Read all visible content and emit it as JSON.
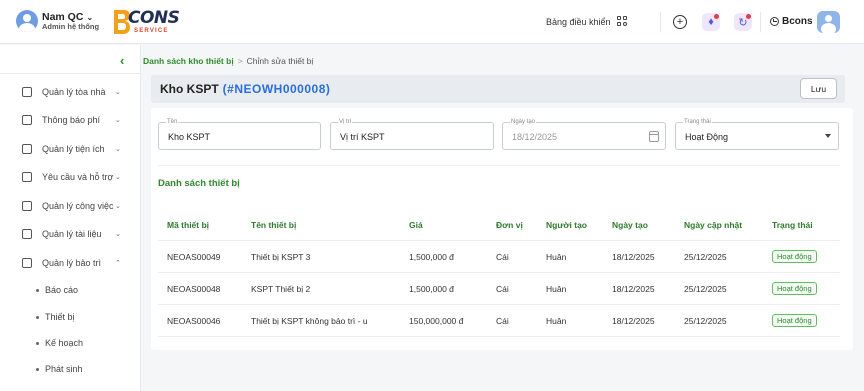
{
  "user": {
    "name": "Nam QC",
    "role": "Admin hệ thống"
  },
  "logo": {
    "word": "CONS",
    "sub": "SERVICE"
  },
  "topbar": {
    "dashboard_label": "Bảng điều khiển",
    "org_name": "Bcons"
  },
  "sidebar": {
    "items": [
      {
        "label": "Quản lý tòa nhà",
        "icon": "building-icon"
      },
      {
        "label": "Thông báo phí",
        "icon": "receipt-icon"
      },
      {
        "label": "Quản lý tiện ích",
        "icon": "grid-icon"
      },
      {
        "label": "Yêu cầu và hỗ trợ",
        "icon": "ticket-icon"
      },
      {
        "label": "Quản lý công việc",
        "icon": "task-icon"
      },
      {
        "label": "Quản lý tài liệu",
        "icon": "document-icon"
      },
      {
        "label": "Quản lý bảo trì",
        "icon": "archive-icon"
      }
    ],
    "subitems": [
      {
        "label": "Báo cáo"
      },
      {
        "label": "Thiết bị"
      },
      {
        "label": "Kế hoạch"
      },
      {
        "label": "Phát sinh"
      }
    ]
  },
  "breadcrumb": {
    "parent": "Danh sách kho thiết bị",
    "current": "Chỉnh sửa thiết bị"
  },
  "header": {
    "title": "Kho KSPT",
    "code": "(#NEOWH000008)",
    "save_label": "Lưu"
  },
  "form": {
    "name": {
      "label": "Tên",
      "value": "Kho KSPT"
    },
    "location": {
      "label": "Vị trí",
      "value": "Vị trí KSPT"
    },
    "created_date": {
      "label": "Ngày tạo",
      "value": "18/12/2025"
    },
    "status": {
      "label": "Trạng thái",
      "value": "Hoạt Động"
    }
  },
  "devices": {
    "title": "Danh sách thiết bị",
    "columns": [
      "Mã thiết bị",
      "Tên thiết bị",
      "Giá",
      "Đơn vị",
      "Người tạo",
      "Ngày tạo",
      "Ngày cập nhật",
      "Trạng thái"
    ],
    "rows": [
      {
        "code": "NEOAS00049",
        "name": "Thiết bị KSPT 3",
        "price": "1,500,000 đ",
        "unit": "Cái",
        "creator": "Huân",
        "created": "18/12/2025",
        "updated": "25/12/2025",
        "status": "Hoạt động"
      },
      {
        "code": "NEOAS00048",
        "name": "KSPT Thiết bị 2",
        "price": "1,500,000 đ",
        "unit": "Cái",
        "creator": "Huân",
        "created": "18/12/2025",
        "updated": "25/12/2025",
        "status": "Hoạt động"
      },
      {
        "code": "NEOAS00046",
        "name": "Thiết bị KSPT không bảo trì - u",
        "price": "150,000,000 đ",
        "unit": "Cái",
        "creator": "Huân",
        "created": "18/12/2025",
        "updated": "25/12/2025",
        "status": "Hoạt động"
      }
    ]
  },
  "colors": {
    "accent_green": "#2d8a2d",
    "code_blue": "#2a6ed8",
    "notify_purple": "#6a4fd6"
  }
}
